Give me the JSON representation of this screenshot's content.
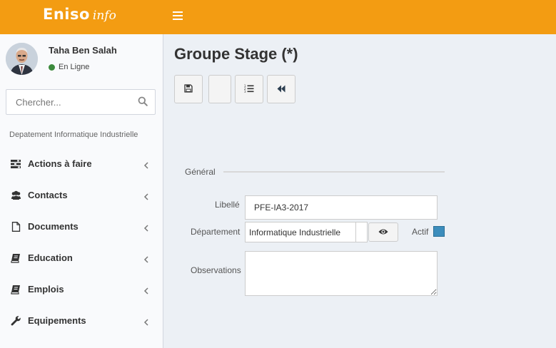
{
  "brand": {
    "name": "Eniso",
    "suffix": "info"
  },
  "user": {
    "name": "Taha Ben Salah",
    "status": "En Ligne"
  },
  "search": {
    "placeholder": "Chercher..."
  },
  "sidebar": {
    "section": "Depatement Informatique Industrielle",
    "items": [
      {
        "label": "Actions à faire",
        "icon": "tasks-icon"
      },
      {
        "label": "Contacts",
        "icon": "users-icon"
      },
      {
        "label": "Documents",
        "icon": "file-icon"
      },
      {
        "label": "Education",
        "icon": "book-icon"
      },
      {
        "label": "Emplois",
        "icon": "book-icon"
      },
      {
        "label": "Equipements",
        "icon": "wrench-icon"
      }
    ]
  },
  "page": {
    "title": "Groupe Stage (*)"
  },
  "toolbar": {
    "buttons": [
      {
        "name": "save-button",
        "icon": "floppy-icon"
      },
      {
        "name": "blank-button",
        "icon": ""
      },
      {
        "name": "list-button",
        "icon": "ordered-list-icon"
      },
      {
        "name": "back-button",
        "icon": "fast-backward-icon"
      }
    ]
  },
  "form": {
    "legend": "Général",
    "libelle": {
      "label": "Libellé",
      "value": "PFE-IA3-2017"
    },
    "departement": {
      "label": "Département",
      "value": "Informatique Industrielle"
    },
    "actif": {
      "label": "Actif",
      "checked": true
    },
    "observations": {
      "label": "Observations",
      "value": ""
    }
  },
  "colors": {
    "header": "#f39c12",
    "sidebar": "#f9fafc",
    "content": "#ecf0f5",
    "checkbox": "#3c8dbc"
  }
}
